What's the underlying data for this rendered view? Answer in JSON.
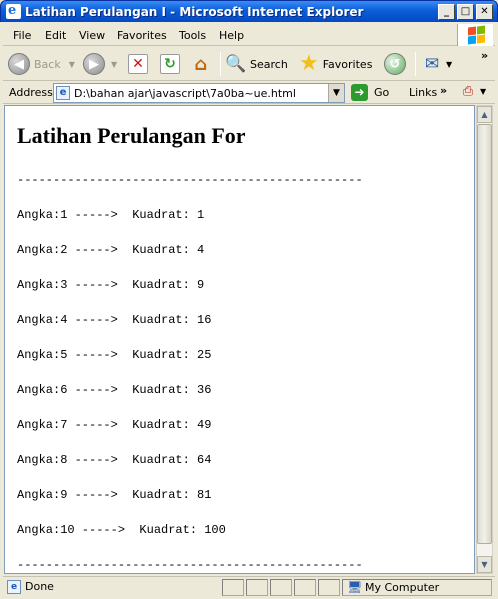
{
  "window": {
    "title": "Latihan Perulangan I - Microsoft Internet Explorer"
  },
  "menu": [
    {
      "label": "File"
    },
    {
      "label": "Edit"
    },
    {
      "label": "View"
    },
    {
      "label": "Favorites"
    },
    {
      "label": "Tools"
    },
    {
      "label": "Help"
    }
  ],
  "toolbar": {
    "back_label": "Back",
    "search_label": "Search",
    "favorites_label": "Favorites"
  },
  "address": {
    "label": "Address",
    "url": "D:\\bahan ajar\\javascript\\7a0ba~ue.html",
    "go_label": "Go",
    "links_label": "Links"
  },
  "page": {
    "heading": "Latihan Perulangan For",
    "divider": "------------------------------------------------",
    "lines": [
      "Angka:1 ----->  Kuadrat: 1",
      "Angka:2 ----->  Kuadrat: 4",
      "Angka:3 ----->  Kuadrat: 9",
      "Angka:4 ----->  Kuadrat: 16",
      "Angka:5 ----->  Kuadrat: 25",
      "Angka:6 ----->  Kuadrat: 36",
      "Angka:7 ----->  Kuadrat: 49",
      "Angka:8 ----->  Kuadrat: 64",
      "Angka:9 ----->  Kuadrat: 81",
      "Angka:10 ----->  Kuadrat: 100"
    ]
  },
  "status": {
    "text": "Done",
    "zone": "My Computer"
  },
  "colors": {
    "titlebar": "#0a5fd8",
    "chrome": "#ece9d8",
    "content_bg": "#ffffff"
  }
}
